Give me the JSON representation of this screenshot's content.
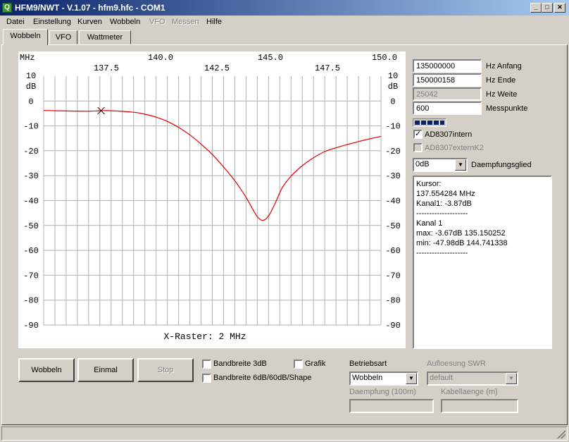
{
  "window": {
    "title": "HFM9/NWT - V.1.07 - hfm9.hfc - COM1",
    "app_icon": "Q",
    "controls": [
      "minimize-icon",
      "maximize-icon",
      "close-icon"
    ]
  },
  "menu": {
    "items": [
      {
        "label": "Datei",
        "enabled": true
      },
      {
        "label": "Einstellung",
        "enabled": true
      },
      {
        "label": "Kurven",
        "enabled": true
      },
      {
        "label": "Wobbeln",
        "enabled": true
      },
      {
        "label": "VFO",
        "enabled": false
      },
      {
        "label": "Messen",
        "enabled": false
      },
      {
        "label": "Hilfe",
        "enabled": true
      }
    ]
  },
  "tabs": [
    {
      "label": "Wobbeln",
      "active": true
    },
    {
      "label": "VFO",
      "active": false
    },
    {
      "label": "Wattmeter",
      "active": false
    }
  ],
  "plot": {
    "freq_unit": "MHz",
    "top_ticks_row1": [
      "140.0",
      "145.0",
      "150.0"
    ],
    "top_ticks_row2": [
      "137.5",
      "142.5",
      "147.5"
    ],
    "db_top_value": "10",
    "db_unit": "dB",
    "y_ticks": [
      "0",
      "-10",
      "-20",
      "-30",
      "-40",
      "-50",
      "-60",
      "-70",
      "-80",
      "-90"
    ],
    "raster_label": "X-Raster: 2 MHz",
    "trace_color": "#e00000",
    "grid_color": "#b0b0b0"
  },
  "chart_data": {
    "type": "line",
    "x_unit": "MHz",
    "y_unit": "dB",
    "xlim": [
      135.0,
      150.0
    ],
    "ylim": [
      -90,
      10
    ],
    "x_grid_step": 2,
    "grid": true,
    "series": [
      {
        "name": "Kanal 1",
        "x": [
          135.0,
          136.0,
          137.0,
          137.55,
          138.0,
          139.0,
          139.5,
          140.0,
          140.5,
          141.0,
          141.5,
          142.0,
          142.5,
          143.0,
          143.5,
          144.0,
          144.3,
          144.5,
          144.74,
          145.0,
          145.3,
          145.6,
          146.0,
          146.5,
          147.0,
          147.5,
          148.0,
          148.5,
          149.0,
          149.5,
          150.0
        ],
        "y": [
          -3.8,
          -4.0,
          -4.1,
          -3.87,
          -3.9,
          -4.5,
          -5.3,
          -6.5,
          -8.2,
          -10.6,
          -13.6,
          -17.3,
          -21.5,
          -26.5,
          -32.0,
          -38.7,
          -43.5,
          -46.5,
          -47.98,
          -46.2,
          -41.0,
          -35.0,
          -30.2,
          -26.0,
          -22.8,
          -20.3,
          -18.8,
          -17.5,
          -16.3,
          -15.2,
          -14.2
        ]
      }
    ],
    "cursor": {
      "x": 137.554284,
      "y": -3.87
    }
  },
  "controls": {
    "hz_anfang": {
      "value": "135000000",
      "label": "Hz Anfang"
    },
    "hz_ende": {
      "value": "150000158",
      "label": "Hz Ende"
    },
    "hz_weite": {
      "value": "25042",
      "label": "Hz Weite"
    },
    "messpunkte": {
      "value": "600",
      "label": "Messpunkte"
    },
    "progress_fraction": 1.0,
    "ad8307_intern": {
      "label": "AD8307intern",
      "checked": true
    },
    "ad8307_extern": {
      "label": "AD8307externK2",
      "checked": false
    },
    "daempfung_select": {
      "value": "0dB",
      "label": "Daempfungsglied"
    }
  },
  "info_lines": [
    "Kursor:",
    "137.554284 MHz",
    "Kanal1: -3.87dB",
    "--------------------",
    "Kanal 1",
    "max: -3.67dB 135.150252",
    "min: -47.98dB 144.741338",
    "--------------------"
  ],
  "bottom": {
    "wobbeln_button": "Wobbeln",
    "einmal_button": "Einmal",
    "stop_button": "Stop",
    "bandbreite_3db": "Bandbreite 3dB",
    "bandbreite_shape": "Bandbreite 6dB/60dB/Shape",
    "grafik": "Grafik",
    "betriebsart_label": "Betriebsart",
    "betriebsart_value": "Wobbeln",
    "aufloesung_label": "Aufloesung SWR",
    "aufloesung_value": "default",
    "daempfung_100m_label": "Daempfung (100m)",
    "kabellaenge_label": "Kabellaenge (m)"
  }
}
